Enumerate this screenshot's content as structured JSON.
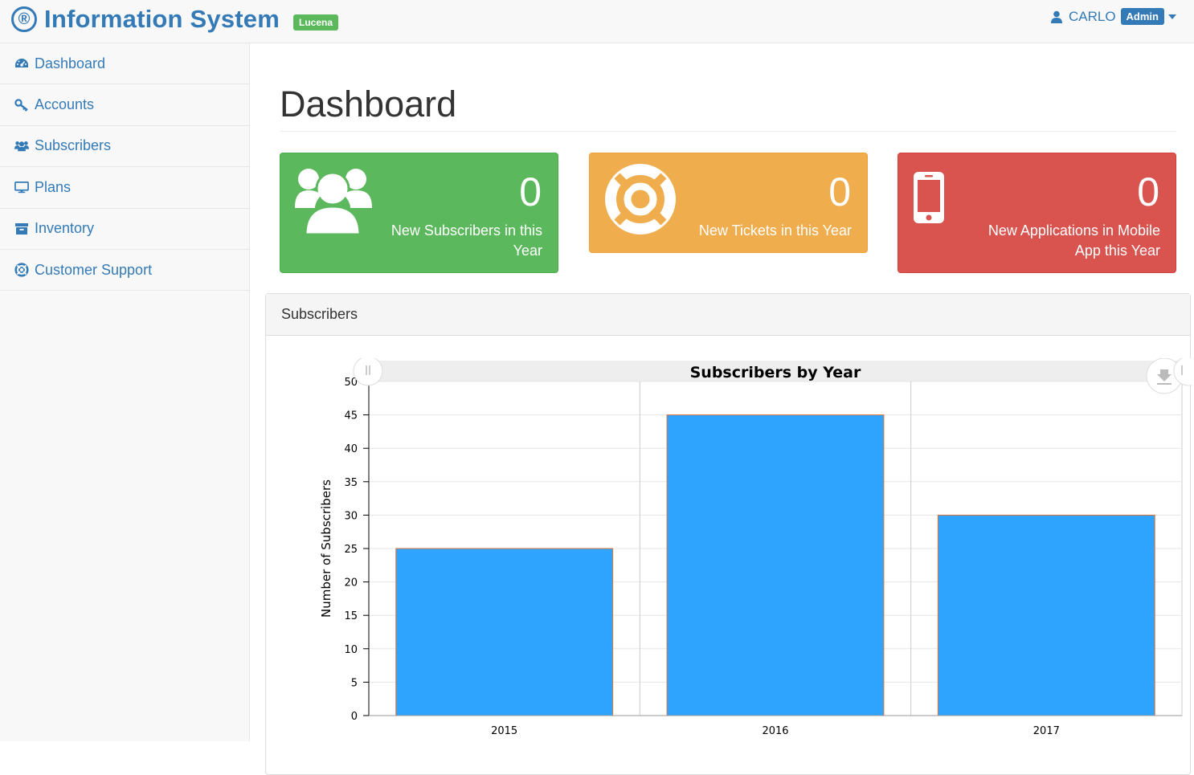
{
  "navbar": {
    "brand_logo": "®",
    "brand_title": "Information System",
    "branch_badge": "Lucena",
    "user_name": "CARLO",
    "user_role": "Admin",
    "colors": {
      "brand": "#337ab7",
      "badge_green": "#5cb85c"
    }
  },
  "sidebar": {
    "items": [
      {
        "label": "Dashboard",
        "icon": "dashboard-icon"
      },
      {
        "label": "Accounts",
        "icon": "key-icon"
      },
      {
        "label": "Subscribers",
        "icon": "users-icon"
      },
      {
        "label": "Plans",
        "icon": "monitor-icon"
      },
      {
        "label": "Inventory",
        "icon": "archive-icon"
      },
      {
        "label": "Customer Support",
        "icon": "lifebuoy-icon"
      }
    ]
  },
  "main": {
    "title": "Dashboard",
    "cards": [
      {
        "count": "0",
        "label": "New Subscribers in this Year",
        "icon": "users-icon",
        "color": "#5cb85c"
      },
      {
        "count": "0",
        "label": "New Tickets in this Year",
        "icon": "lifebuoy-icon",
        "color": "#f0ad4e"
      },
      {
        "count": "0",
        "label": "New Applications in Mobile App this Year",
        "icon": "mobile-phone-icon",
        "color": "#d9534f"
      }
    ],
    "panel_heading": "Subscribers"
  },
  "chart_data": {
    "type": "bar",
    "title": "Subscribers by Year",
    "xlabel": "",
    "ylabel": "Number of Subscribers",
    "categories": [
      "2015",
      "2016",
      "2017"
    ],
    "values": [
      25,
      45,
      30
    ],
    "ylim": [
      0,
      50
    ],
    "yticks": [
      0,
      5,
      10,
      15,
      20,
      25,
      30,
      35,
      40,
      45,
      50
    ],
    "grid": true,
    "bar_color": "#2fa4ff",
    "bar_border_color": "#e6732d"
  }
}
